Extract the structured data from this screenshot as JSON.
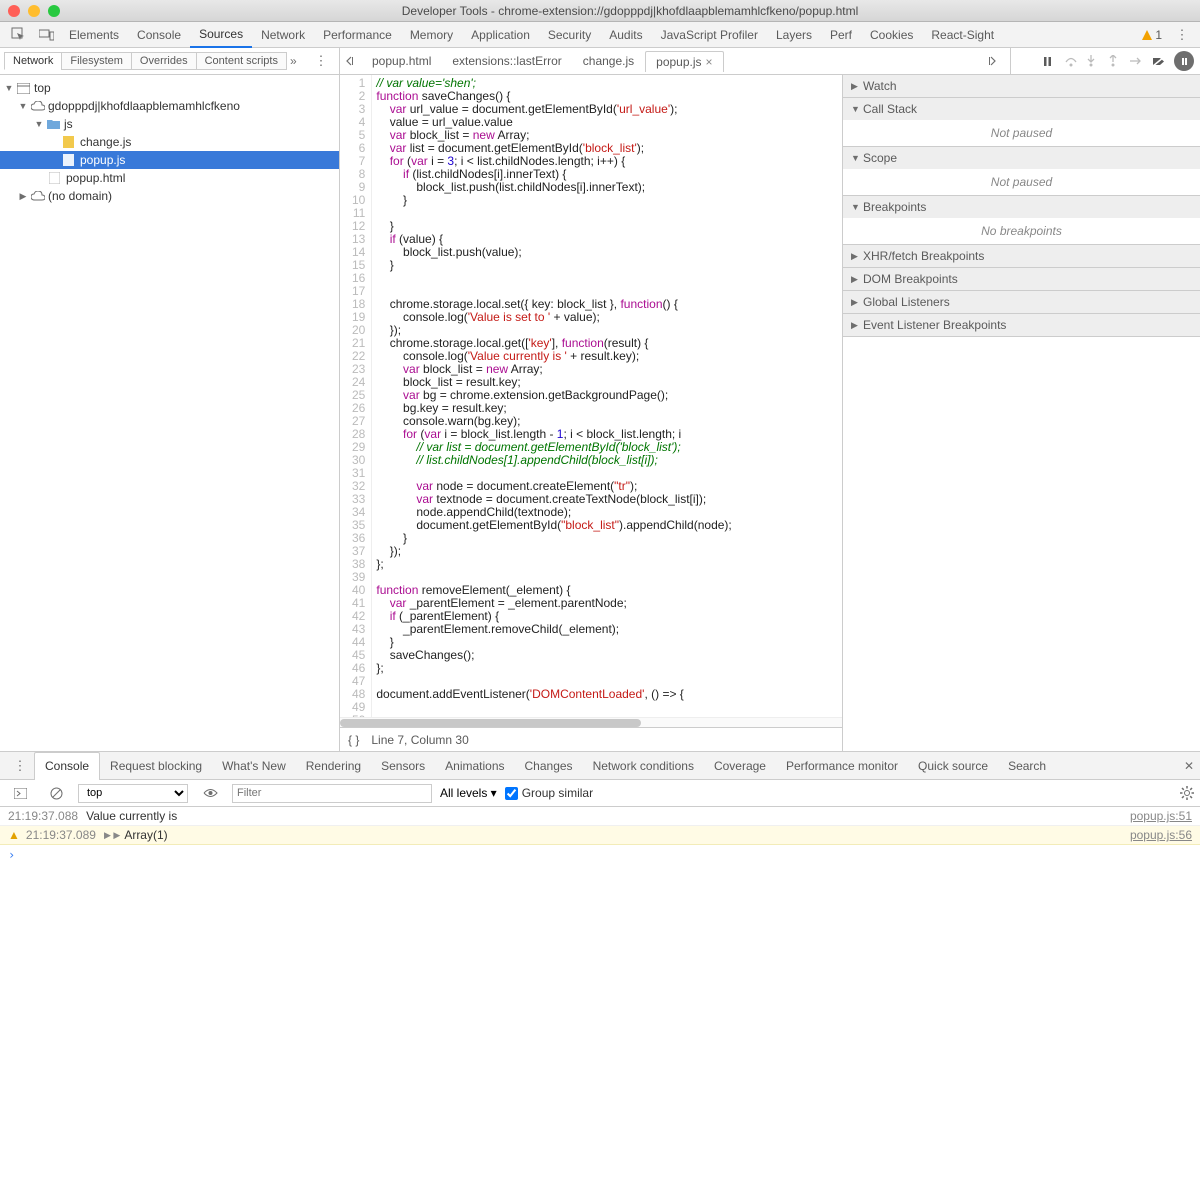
{
  "window": {
    "title": "Developer Tools - chrome-extension://gdopppdj|khofdlaapblemamhlcfkeno/popup.html"
  },
  "mainTabs": [
    "Elements",
    "Console",
    "Sources",
    "Network",
    "Performance",
    "Memory",
    "Application",
    "Security",
    "Audits",
    "JavaScript Profiler",
    "Layers",
    "Perf",
    "Cookies",
    "React-Sight"
  ],
  "mainActive": "Sources",
  "warnCount": "1",
  "subTabs": {
    "left": [
      "Network",
      "Filesystem",
      "Overrides",
      "Content scripts"
    ],
    "leftActive": "Network"
  },
  "fileTabs": [
    {
      "label": "popup.html",
      "active": false
    },
    {
      "label": "extensions::lastError",
      "active": false
    },
    {
      "label": "change.js",
      "active": false
    },
    {
      "label": "popup.js",
      "active": true
    }
  ],
  "tree": {
    "top": "top",
    "ext": "gdopppdj|khofdlaapblemamhlcfkeno",
    "folder": "js",
    "files": [
      "change.js",
      "popup.js"
    ],
    "rootFile": "popup.html",
    "noDomain": "(no domain)"
  },
  "status": {
    "pos": "Line 7, Column 30"
  },
  "debugger": {
    "watch": "Watch",
    "callstack": "Call Stack",
    "notPaused": "Not paused",
    "scope": "Scope",
    "breakpoints": "Breakpoints",
    "noBreakpoints": "No breakpoints",
    "xhr": "XHR/fetch Breakpoints",
    "dom": "DOM Breakpoints",
    "global": "Global Listeners",
    "event": "Event Listener Breakpoints"
  },
  "drawerTabs": [
    "Console",
    "Request blocking",
    "What's New",
    "Rendering",
    "Sensors",
    "Animations",
    "Changes",
    "Network conditions",
    "Coverage",
    "Performance monitor",
    "Quick source",
    "Search"
  ],
  "drawerActive": "Console",
  "consoleTb": {
    "ctx": "top",
    "filterPh": "Filter",
    "levels": "All levels ▾",
    "group": "Group similar"
  },
  "console": [
    {
      "ts": "21:19:37.088",
      "msg": "Value currently is",
      "src": "popup.js:51",
      "warn": false
    },
    {
      "ts": "21:19:37.089",
      "msg": "Array(1)",
      "src": "popup.js:56",
      "warn": true,
      "expandable": true
    }
  ],
  "code": {
    "lines": 50,
    "src": [
      {
        "t": "// var value='shen';",
        "c": "com"
      },
      {
        "h": "<span class='kw'>function</span> saveChanges() {"
      },
      {
        "h": "    <span class='kw'>var</span> url_value = document.getElementById(<span class='str'>'url_value'</span>);"
      },
      {
        "h": "    value = url_value.value"
      },
      {
        "h": "    <span class='kw'>var</span> block_list = <span class='kw'>new</span> Array;"
      },
      {
        "h": "    <span class='kw'>var</span> list = document.getElementById(<span class='str'>'block_list'</span>);"
      },
      {
        "h": "    <span class='kw'>for</span> (<span class='kw'>var</span> i = <span class='num'>3</span>; i &lt; list.childNodes.length; i++) {"
      },
      {
        "h": "        <span class='kw'>if</span> (list.childNodes[i].innerText) {"
      },
      {
        "h": "            block_list.push(list.childNodes[i].innerText);"
      },
      {
        "h": "        }"
      },
      {
        "h": ""
      },
      {
        "h": "    }"
      },
      {
        "h": "    <span class='kw'>if</span> (value) {"
      },
      {
        "h": "        block_list.push(value);"
      },
      {
        "h": "    }"
      },
      {
        "h": ""
      },
      {
        "h": ""
      },
      {
        "h": "    chrome.storage.local.set({ key: block_list }, <span class='kw'>function</span>() {"
      },
      {
        "h": "        console.log(<span class='str'>'Value is set to '</span> + value);"
      },
      {
        "h": "    });"
      },
      {
        "h": "    chrome.storage.local.get([<span class='str'>'key'</span>], <span class='kw'>function</span>(result) {"
      },
      {
        "h": "        console.log(<span class='str'>'Value currently is '</span> + result.key);"
      },
      {
        "h": "        <span class='kw'>var</span> block_list = <span class='kw'>new</span> Array;"
      },
      {
        "h": "        block_list = result.key;"
      },
      {
        "h": "        <span class='kw'>var</span> bg = chrome.extension.getBackgroundPage();"
      },
      {
        "h": "        bg.key = result.key;"
      },
      {
        "h": "        console.warn(bg.key);"
      },
      {
        "h": "        <span class='kw'>for</span> (<span class='kw'>var</span> i = block_list.length - <span class='num'>1</span>; i &lt; block_list.length; i"
      },
      {
        "h": "            <span class='com'>// var list = document.getElementById('block_list');</span>"
      },
      {
        "h": "            <span class='com'>// list.childNodes[1].appendChild(block_list[i]);</span>"
      },
      {
        "h": ""
      },
      {
        "h": "            <span class='kw'>var</span> node = document.createElement(<span class='str'>\"tr\"</span>);"
      },
      {
        "h": "            <span class='kw'>var</span> textnode = document.createTextNode(block_list[i]);"
      },
      {
        "h": "            node.appendChild(textnode);"
      },
      {
        "h": "            document.getElementById(<span class='str'>\"block_list\"</span>).appendChild(node);"
      },
      {
        "h": "        }"
      },
      {
        "h": "    });"
      },
      {
        "h": "};"
      },
      {
        "h": ""
      },
      {
        "h": "<span class='kw'>function</span> removeElement(_element) {"
      },
      {
        "h": "    <span class='kw'>var</span> _parentElement = _element.parentNode;"
      },
      {
        "h": "    <span class='kw'>if</span> (_parentElement) {"
      },
      {
        "h": "        _parentElement.removeChild(_element);"
      },
      {
        "h": "    }"
      },
      {
        "h": "    saveChanges();"
      },
      {
        "h": "};"
      },
      {
        "h": ""
      },
      {
        "h": "document.addEventListener(<span class='str'>'DOMContentLoaded'</span>, () =&gt; {"
      },
      {
        "h": ""
      }
    ]
  }
}
